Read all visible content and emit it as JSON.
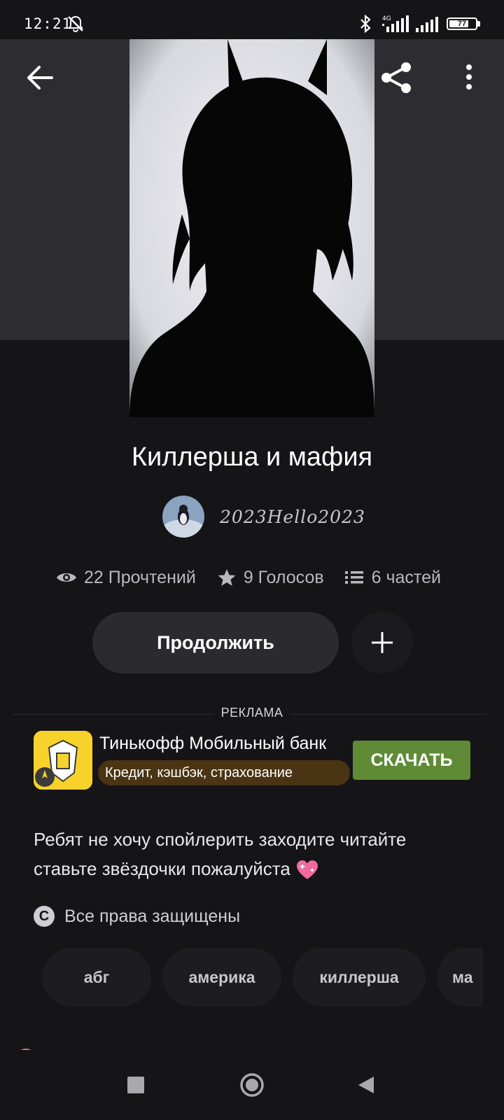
{
  "status_bar": {
    "time": "12:21",
    "network": "4G",
    "battery": "77",
    "battery_level": 0.77,
    "icons": [
      "mute-icon",
      "bluetooth-icon",
      "signal-icon",
      "battery-icon"
    ]
  },
  "header": {
    "back_icon": "arrow-left-icon",
    "share_icon": "share-icon",
    "more_icon": "more-vertical-icon"
  },
  "story": {
    "title": "Киллерша и мафия",
    "author": "2023Hello2023",
    "stats": {
      "reads": "22 Прочтений",
      "votes": "9 Голосов",
      "parts": "6 частей"
    },
    "continue_label": "Продолжить",
    "add_icon": "plus-icon",
    "description": "Ребят не хочу спойлерить заходите читайте ставьте звёздочки пожалуйста",
    "copyright": "Все права защищены",
    "tags": [
      "абг",
      "америка",
      "киллерша",
      "ма"
    ]
  },
  "ad": {
    "label": "РЕКЛАМА",
    "title": "Тинькофф Мобильный банк",
    "subtitle": "Кредит, кэшбэк, страхование",
    "button": "СКАЧАТЬ"
  },
  "colors": {
    "background": "#151417",
    "header_band": "#2d2c30",
    "ad_button": "#5f8b37",
    "ad_icon": "#f6d22b",
    "ad_subtitle_bg": "#4a3413",
    "accent_dot": "#f0703a"
  },
  "navbar": {
    "icons": [
      "recent-apps-icon",
      "home-icon",
      "nav-back-icon"
    ]
  }
}
